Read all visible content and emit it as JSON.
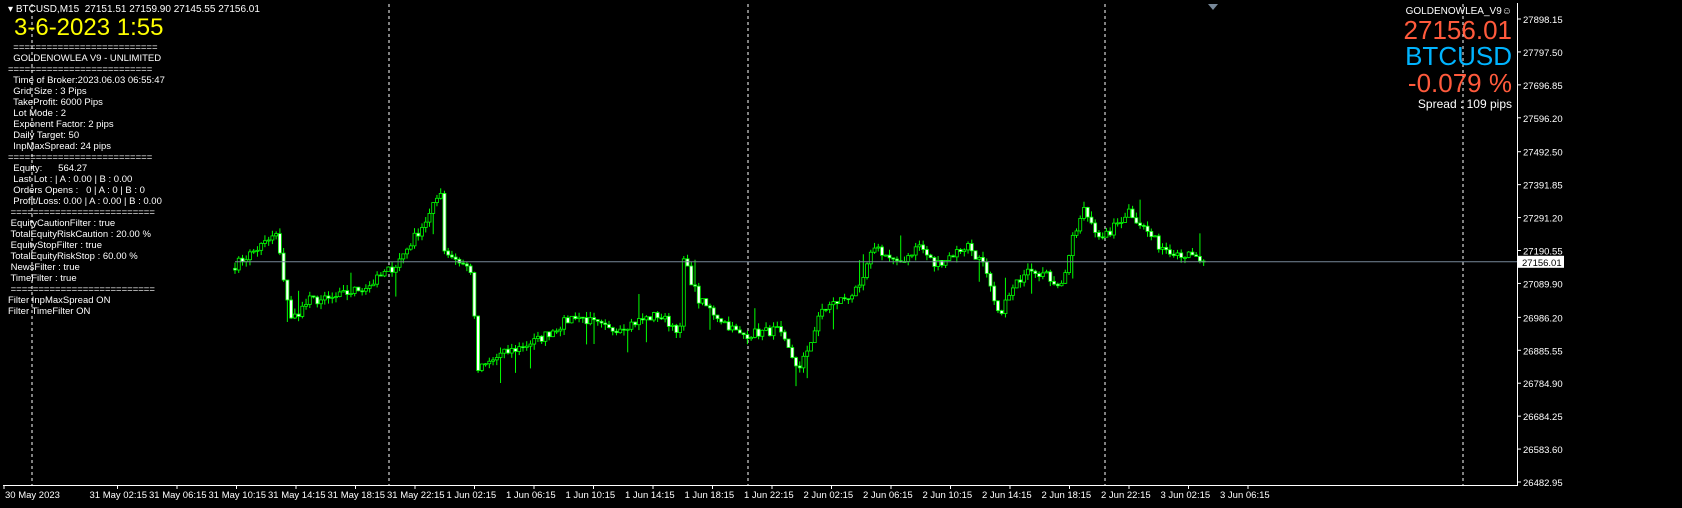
{
  "header": {
    "symbol_tf": "BTCUSD,M15",
    "ohlc": "27151.51 27159.90 27145.55 27156.01"
  },
  "overlay": {
    "date_time": "3-6-2023 1:55",
    "lines": [
      "  ==========================",
      "  GOLDENOWLEA V9 - UNLIMITED",
      "==========================",
      "  Time of Broker:2023.06.03 06:55:47",
      "  Grid Size : 3 Pips",
      "  TakeProfit: 6000 Pips",
      "  Lot Mode : 2",
      "  Exponent Factor: 2 pips",
      "  Daily Target: 50",
      "  InpMaxSpread: 24 pips",
      "==========================",
      "  Equity:      564.27",
      "  Last Lot : | A : 0.00 | B : 0.00",
      "  Orders Opens :   0 | A : 0 | B : 0",
      "  Profit/Loss: 0.00 | A : 0.00 | B : 0.00",
      " ==========================",
      " EquityCautionFilter : true",
      " TotalEquityRiskCaution : 20.00 %",
      " EquityStopFilter : true",
      " TotalEquityRiskStop : 60.00 %",
      " NewsFilter : true",
      " TimeFilter : true",
      " ==========================",
      "Filter InpMaxSpread ON",
      "Filter TimeFilter ON"
    ]
  },
  "panel": {
    "ea_name": "GOLDENOWLEA_V9",
    "smiley": "☺",
    "price": "27156.01",
    "symbol": "BTCUSD",
    "change": "-0.079 %",
    "spread": "Spread : 109 pips"
  },
  "colors": {
    "bull": "#00ff00",
    "bear": "#00ff00",
    "body_bear": "#ffffff",
    "bid_line": "#778899",
    "grid": "#ffffff"
  },
  "chart_data": {
    "type": "candlestick",
    "ylim": [
      26482.95,
      27898.15
    ],
    "current_price": "27156.01",
    "y_ticks": [
      "27898.15",
      "27797.50",
      "27696.85",
      "27596.20",
      "27492.50",
      "27391.85",
      "27291.20",
      "27190.55",
      "27089.90",
      "26986.20",
      "26885.55",
      "26784.90",
      "26684.25",
      "26583.60",
      "26482.95"
    ],
    "x_ticks": [
      "30 May 2023",
      "31 May 02:15",
      "31 May 06:15",
      "31 May 10:15",
      "31 May 14:15",
      "31 May 18:15",
      "31 May 22:15",
      "1 Jun 02:15",
      "1 Jun 06:15",
      "1 Jun 10:15",
      "1 Jun 14:15",
      "1 Jun 18:15",
      "1 Jun 22:15",
      "2 Jun 02:15",
      "2 Jun 06:15",
      "2 Jun 10:15",
      "2 Jun 14:15",
      "2 Jun 18:15",
      "2 Jun 22:15",
      "3 Jun 02:15",
      "3 Jun 06:15"
    ],
    "bars": 260,
    "close_keypoints": [
      [
        0,
        27146
      ],
      [
        11,
        27238
      ],
      [
        15,
        26978
      ],
      [
        20,
        27039
      ],
      [
        25,
        27039
      ],
      [
        36,
        27085
      ],
      [
        43,
        27146
      ],
      [
        52,
        27299
      ],
      [
        55,
        27375
      ],
      [
        56,
        27192
      ],
      [
        63,
        27131
      ],
      [
        65,
        26825
      ],
      [
        71,
        26871
      ],
      [
        81,
        26917
      ],
      [
        91,
        26993
      ],
      [
        100,
        26947
      ],
      [
        113,
        26993
      ],
      [
        119,
        26947
      ],
      [
        120,
        27161
      ],
      [
        124,
        27039
      ],
      [
        135,
        26932
      ],
      [
        145,
        26947
      ],
      [
        151,
        26825
      ],
      [
        157,
        27009
      ],
      [
        167,
        27070
      ],
      [
        171,
        27207
      ],
      [
        177,
        27146
      ],
      [
        183,
        27207
      ],
      [
        187,
        27146
      ],
      [
        196,
        27207
      ],
      [
        200,
        27146
      ],
      [
        204,
        26993
      ],
      [
        212,
        27146
      ],
      [
        221,
        27085
      ],
      [
        224,
        27222
      ],
      [
        227,
        27314
      ],
      [
        232,
        27222
      ],
      [
        239,
        27314
      ],
      [
        247,
        27207
      ],
      [
        259,
        27156
      ]
    ]
  }
}
